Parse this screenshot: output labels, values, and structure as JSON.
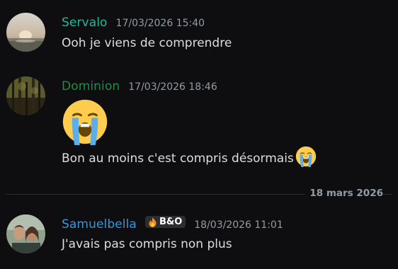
{
  "messages": [
    {
      "author": "Servalo",
      "author_color": "#1abc9c",
      "timestamp": "17/03/2026 15:40",
      "text": "Ooh je viens de comprendre",
      "avatar": "avatar-beach-sunset"
    },
    {
      "author": "Dominion",
      "author_color": "#1f8b4c",
      "timestamp": "17/03/2026 18:46",
      "big_emoji": "loudly-crying-face-emoji",
      "text": "Bon au moins c'est compris désormais",
      "inline_emoji": "loudly-crying-face-emoji",
      "avatar": "avatar-forest"
    },
    {
      "author": "Samuelbella",
      "author_color": "#3498db",
      "badge": {
        "icon": "fire-icon",
        "label": "B&O"
      },
      "timestamp": "18/03/2026 11:01",
      "text": "J'avais pas compris non plus",
      "avatar": "avatar-two-people"
    }
  ],
  "date_divider": "18 mars 2026",
  "colors": {
    "background": "#0e0e11",
    "text": "#dbdee1",
    "muted": "#949ba4"
  }
}
